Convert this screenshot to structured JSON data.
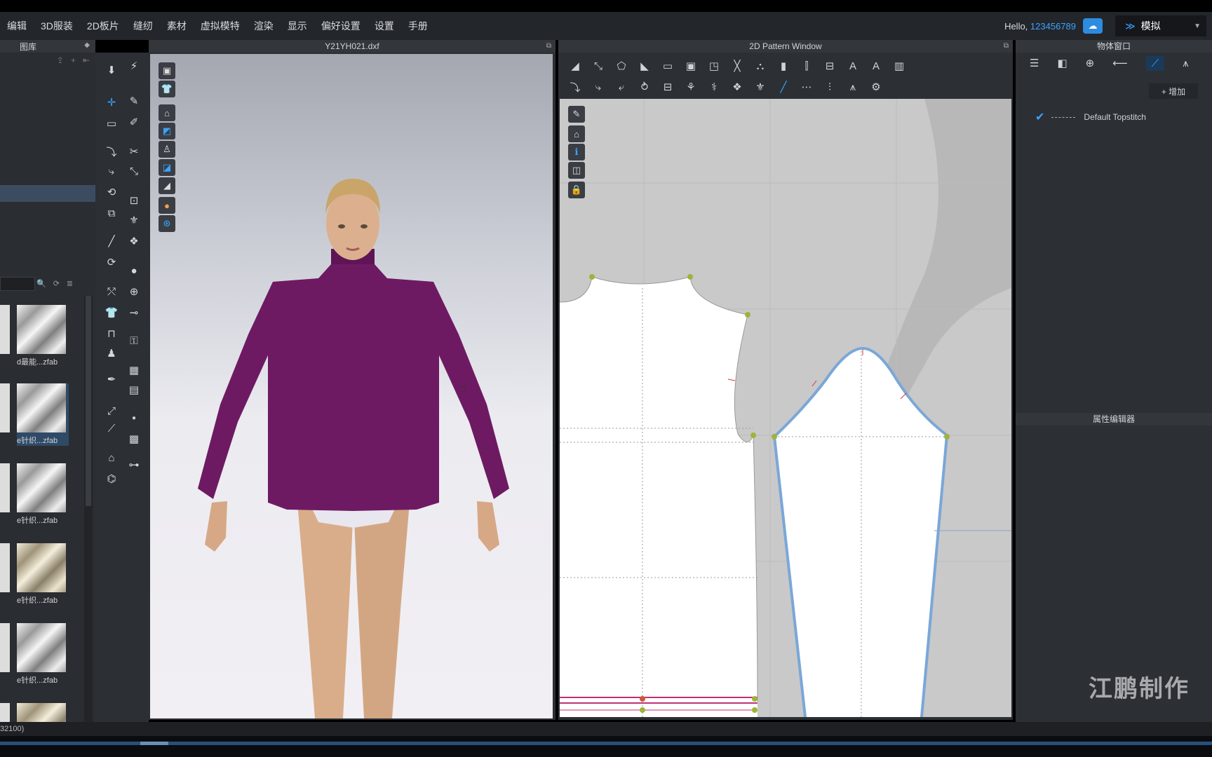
{
  "menu": [
    "编辑",
    "3D服装",
    "2D板片",
    "缝纫",
    "素材",
    "虚拟模特",
    "渲染",
    "显示",
    "偏好设置",
    "设置",
    "手册"
  ],
  "header": {
    "hello": "Hello, ",
    "user": "123456789",
    "mode": "模拟"
  },
  "library": {
    "title": "图库",
    "fabrics": [
      {
        "label": "d最能...zfab",
        "tone": "white",
        "selected": false
      },
      {
        "label": "e针织...zfab",
        "tone": "white",
        "selected": true
      },
      {
        "label": "e针织...zfab",
        "tone": "white",
        "selected": false
      },
      {
        "label": "e针织...zfab",
        "tone": "beige",
        "selected": false
      },
      {
        "label": "e针织...zfab",
        "tone": "white",
        "selected": false
      },
      {
        "label": "",
        "tone": "beige",
        "selected": false
      }
    ]
  },
  "view3d": {
    "title": "Y21YH021.dxf"
  },
  "view2d": {
    "title": "2D Pattern Window"
  },
  "object_panel": {
    "title": "物体窗口",
    "add_label": "+ 增加",
    "item": "Default Topstitch"
  },
  "property_panel": {
    "title": "属性编辑器"
  },
  "watermark": "江鹏制作",
  "status": "32100)",
  "colors": {
    "garment": "#6e1a63",
    "accent": "#3aa4ff",
    "seam": "#7aa7d8"
  }
}
